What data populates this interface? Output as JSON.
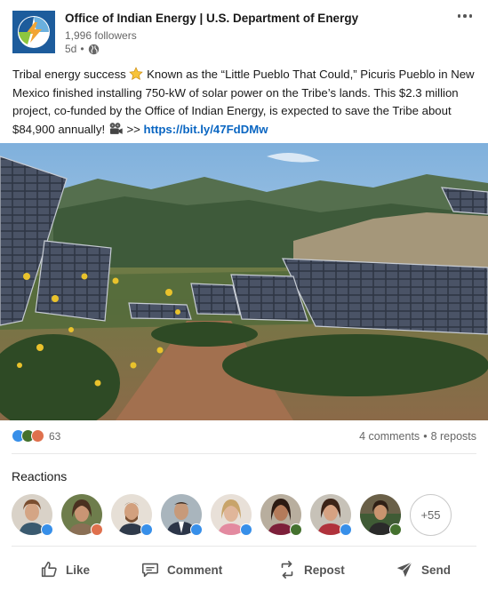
{
  "header": {
    "org_name": "Office of Indian Energy | U.S. Department of Energy",
    "followers": "1,996 followers",
    "post_age": "5d",
    "visibility_icon": "globe-icon",
    "more_icon": "more-horizontal-icon"
  },
  "post": {
    "text_1": "Tribal energy success ",
    "text_2": " Known as the “Little Pueblo That Could,” Picuris Pueblo in New Mexico finished installing 750-kW of solar power on the Tribe’s lands. This $2.3 million project, co-funded by the Office of Indian Energy, is expected to save the Tribe about $84,900 annually! ",
    "text_3": " >> ",
    "link": "https://bit.ly/47FdDMw",
    "emoji_1": "star-icon",
    "emoji_2": "film-projector-icon"
  },
  "stats": {
    "reaction_count": "63",
    "comments": "4 comments",
    "separator": "•",
    "reposts": "8 reposts"
  },
  "reactions": {
    "title": "Reactions",
    "more": "+55"
  },
  "actions": {
    "like": "Like",
    "comment": "Comment",
    "repost": "Repost",
    "send": "Send"
  },
  "colors": {
    "link": "#0a66c2",
    "like_blue": "#378fe9",
    "celebrate_green": "#44712e",
    "love_red": "#df704d",
    "logo_blue": "#1d5c9c"
  }
}
